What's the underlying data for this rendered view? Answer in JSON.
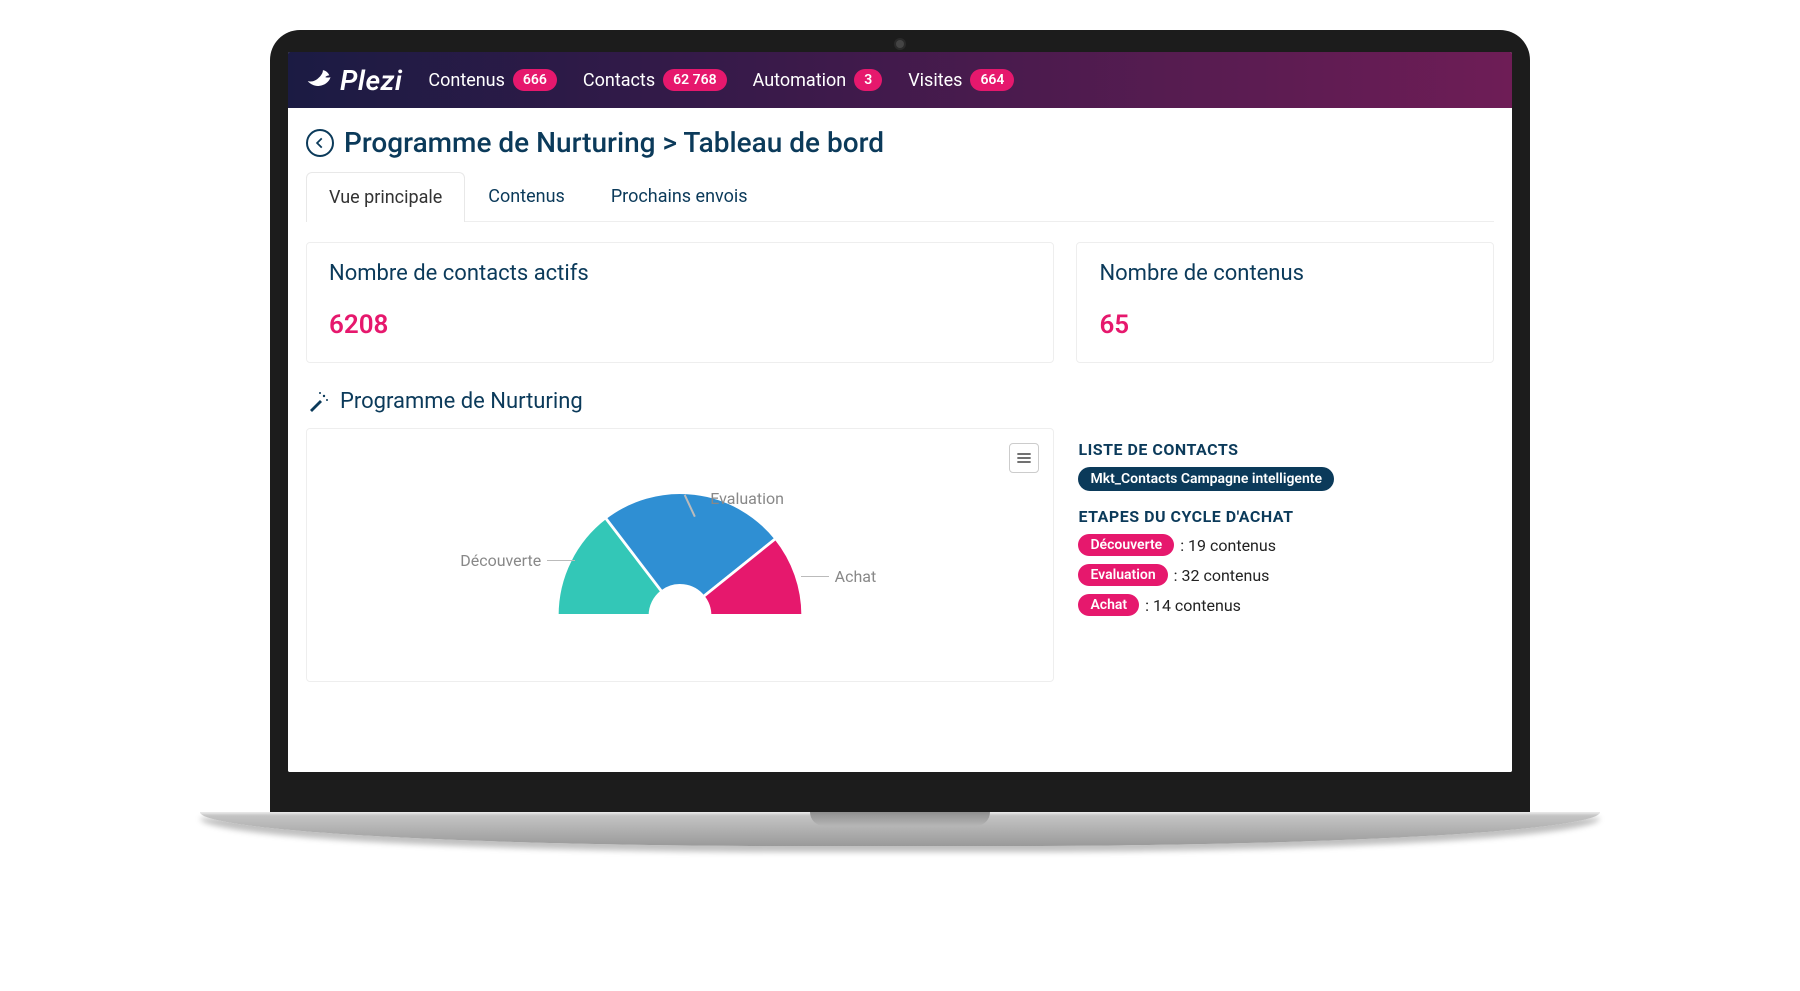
{
  "brand": "Plezi",
  "nav": [
    {
      "label": "Contenus",
      "count": "666"
    },
    {
      "label": "Contacts",
      "count": "62 768"
    },
    {
      "label": "Automation",
      "count": "3"
    },
    {
      "label": "Visites",
      "count": "664"
    }
  ],
  "breadcrumb": {
    "parent": "Programme de Nurturing",
    "sep": ">",
    "child": "Tableau de bord"
  },
  "tabs": [
    {
      "label": "Vue principale",
      "active": true
    },
    {
      "label": "Contenus",
      "active": false
    },
    {
      "label": "Prochains envois",
      "active": false
    }
  ],
  "stats": {
    "contacts": {
      "title": "Nombre de contacts actifs",
      "value": "6208"
    },
    "contenus": {
      "title": "Nombre de contenus",
      "value": "65"
    }
  },
  "section": {
    "title": "Programme de Nurturing"
  },
  "chart_data": {
    "type": "pie",
    "title": "Programme de Nurturing",
    "series": [
      {
        "name": "Découverte",
        "value": 19,
        "color": "#33c7b7"
      },
      {
        "name": "Evaluation",
        "value": 32,
        "color": "#2f8fd3"
      },
      {
        "name": "Achat",
        "value": 14,
        "color": "#e6186d"
      }
    ],
    "note": "semi-donut over 180°; values correspond to content counts shown in the side legend"
  },
  "side": {
    "contacts_heading": "LISTE DE CONTACTS",
    "contacts_chip": "Mkt_Contacts Campagne intelligente",
    "stages_heading": "ETAPES DU CYCLE D'ACHAT",
    "stages": [
      {
        "name": "Découverte",
        "text": ": 19 contenus"
      },
      {
        "name": "Evaluation",
        "text": ": 32 contenus"
      },
      {
        "name": "Achat",
        "text": ": 14 contenus"
      }
    ]
  },
  "colors": {
    "pink": "#e6186d",
    "navy": "#0b3a5a",
    "teal": "#33c7b7",
    "blue": "#2f8fd3"
  }
}
